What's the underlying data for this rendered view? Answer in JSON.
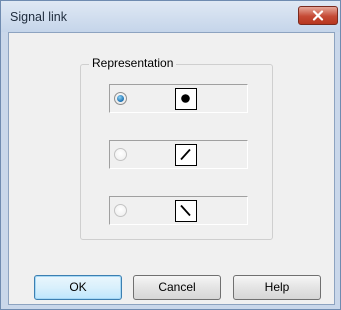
{
  "window": {
    "title": "Signal link"
  },
  "group": {
    "label": "Representation",
    "options": [
      {
        "symbol": "dot-symbol",
        "selected": true,
        "enabled": true
      },
      {
        "symbol": "slash-symbol",
        "selected": false,
        "enabled": false
      },
      {
        "symbol": "backslash-symbol",
        "selected": false,
        "enabled": false
      }
    ]
  },
  "buttons": {
    "ok": "OK",
    "cancel": "Cancel",
    "help": "Help"
  },
  "colors": {
    "close_button": "#c54a35",
    "window_frame": "#c9d7ea",
    "dialog_background": "#f0f0f0",
    "selected_radio": "#1b6fb0"
  }
}
